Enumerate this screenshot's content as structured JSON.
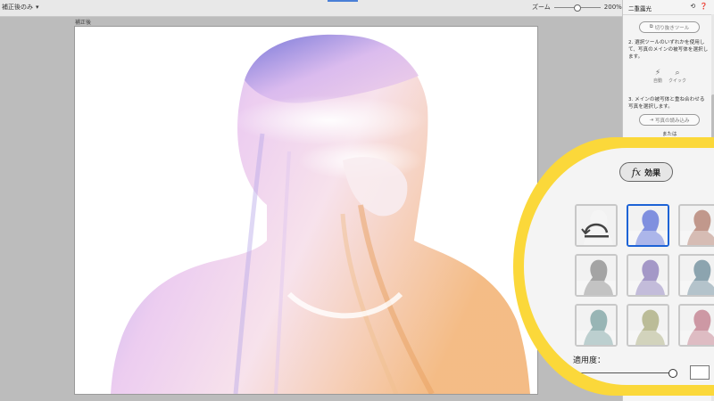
{
  "topbar": {
    "view_label": "補正後のみ",
    "zoom_label": "ズーム",
    "zoom_value": "200%",
    "zoom_fraction": 0.5
  },
  "canvas": {
    "label": "補正後"
  },
  "panel": {
    "title": "二重露光",
    "cut_tool_button": "切り抜きツール",
    "step2_text": "2. 選択ツールのいずれかを使用して、写真のメインの被写体を選択します。",
    "tools": [
      {
        "label": "自動",
        "icon": "magic-wand-icon"
      },
      {
        "label": "クイック",
        "icon": "quick-select-icon"
      }
    ],
    "step3_text": "3. メインの被写体と重ね合わせる写真を選択します。",
    "import_button": "写真の読み込み",
    "or_text": "または"
  },
  "effects": {
    "fx_symbol": "fx",
    "title": "効果",
    "amount_label": "適用度：",
    "amount_fraction": 0.95,
    "highlight_color": "#fbd83a",
    "selected_color": "#1d63d6",
    "thumbnails": [
      {
        "name": "none",
        "tint": "#ffffff",
        "selected": false
      },
      {
        "name": "blue-orange",
        "tint": "#5a6fd8",
        "selected": true
      },
      {
        "name": "warm",
        "tint": "#b07a6a",
        "selected": false
      },
      {
        "name": "gray",
        "tint": "#8a8a8a",
        "selected": false
      },
      {
        "name": "purple-green",
        "tint": "#8a7ab8",
        "selected": false
      },
      {
        "name": "teal-gray",
        "tint": "#6a8a98",
        "selected": false
      },
      {
        "name": "cool-green",
        "tint": "#7aa0a0",
        "selected": false
      },
      {
        "name": "sepia-green",
        "tint": "#a8aa7a",
        "selected": false
      },
      {
        "name": "pink",
        "tint": "#c07a8a",
        "selected": false
      }
    ]
  }
}
